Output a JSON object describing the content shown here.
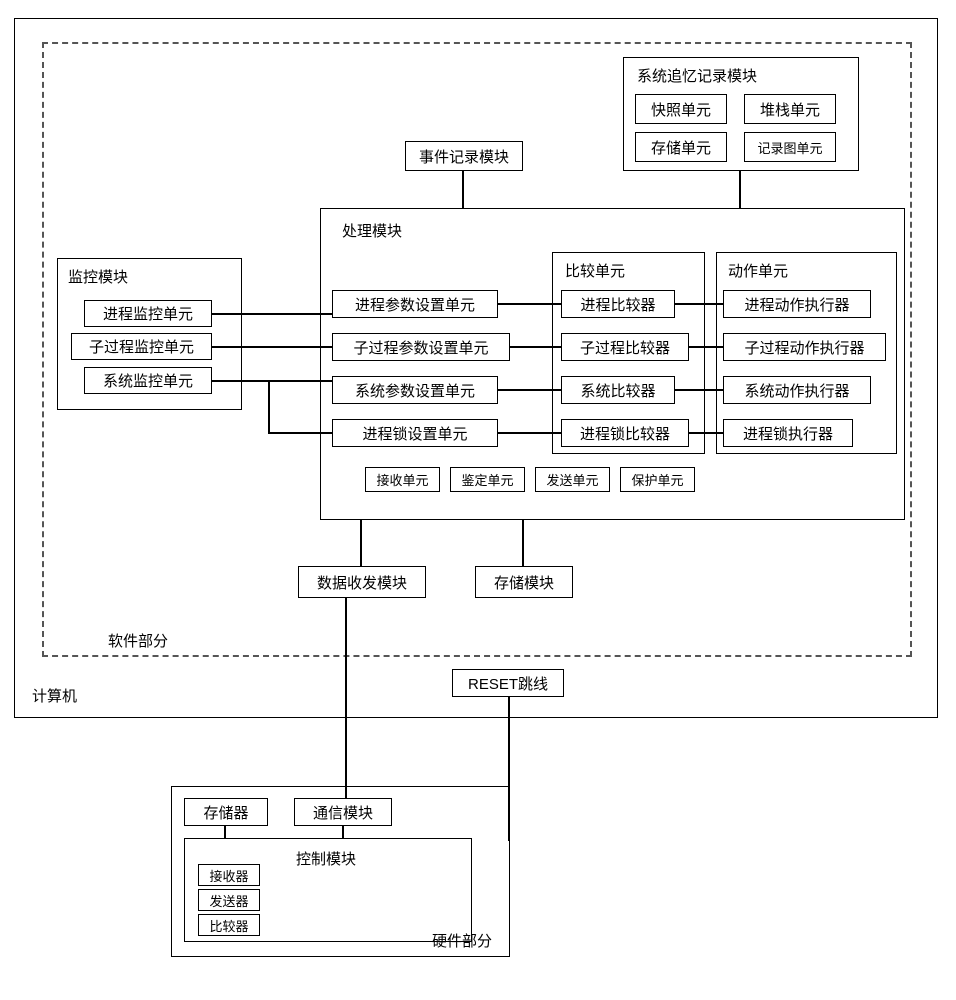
{
  "computer_label": "计算机",
  "software_label": "软件部分",
  "hardware_label": "硬件部分",
  "event_log_module": "事件记录模块",
  "system_recall_module": "系统追忆记录模块",
  "snapshot_unit": "快照单元",
  "stack_unit": "堆栈单元",
  "storage_unit": "存储单元",
  "record_graph_unit": "记录图单元",
  "monitor_module": "监控模块",
  "process_monitor_unit": "进程监控单元",
  "subprocess_monitor_unit": "子过程监控单元",
  "system_monitor_unit": "系统监控单元",
  "processing_module": "处理模块",
  "process_param_set_unit": "进程参数设置单元",
  "subprocess_param_set_unit": "子过程参数设置单元",
  "system_param_set_unit": "系统参数设置单元",
  "process_lock_set_unit": "进程锁设置单元",
  "compare_unit": "比较单元",
  "process_comparator": "进程比较器",
  "subprocess_comparator": "子过程比较器",
  "system_comparator": "系统比较器",
  "process_lock_comparator": "进程锁比较器",
  "action_unit": "动作单元",
  "process_action_executor": "进程动作执行器",
  "subprocess_action_executor": "子过程动作执行器",
  "system_action_executor": "系统动作执行器",
  "process_lock_executor": "进程锁执行器",
  "receive_unit": "接收单元",
  "identify_unit": "鉴定单元",
  "send_unit": "发送单元",
  "protect_unit": "保护单元",
  "data_txrx_module": "数据收发模块",
  "storage_module": "存储模块",
  "reset_jumper": "RESET跳线",
  "memory": "存储器",
  "comm_module": "通信模块",
  "control_module": "控制模块",
  "receiver": "接收器",
  "sender": "发送器",
  "comparator": "比较器"
}
